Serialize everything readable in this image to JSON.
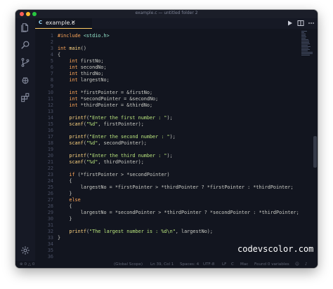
{
  "window": {
    "title": "example.c — untitled folder 2"
  },
  "tab": {
    "lang": "C",
    "filename": "example.c",
    "close": "×"
  },
  "code": [
    {
      "n": "1",
      "segs": [
        {
          "c": "k",
          "t": "#include "
        },
        {
          "c": "g",
          "t": "<stdio.h>"
        }
      ]
    },
    {
      "n": "2",
      "segs": []
    },
    {
      "n": "3",
      "segs": [
        {
          "c": "k",
          "t": "int "
        },
        {
          "c": "f",
          "t": "main"
        },
        {
          "c": "",
          "t": "()"
        }
      ]
    },
    {
      "n": "4",
      "segs": [
        {
          "c": "",
          "t": "{"
        }
      ]
    },
    {
      "n": "5",
      "segs": [
        {
          "c": "",
          "t": "    "
        },
        {
          "c": "k",
          "t": "int "
        },
        {
          "c": "",
          "t": "firstNo;"
        }
      ]
    },
    {
      "n": "6",
      "segs": [
        {
          "c": "",
          "t": "    "
        },
        {
          "c": "k",
          "t": "int "
        },
        {
          "c": "",
          "t": "secondNo;"
        }
      ]
    },
    {
      "n": "7",
      "segs": [
        {
          "c": "",
          "t": "    "
        },
        {
          "c": "k",
          "t": "int "
        },
        {
          "c": "",
          "t": "thirdNo;"
        }
      ]
    },
    {
      "n": "8",
      "segs": [
        {
          "c": "",
          "t": "    "
        },
        {
          "c": "k",
          "t": "int "
        },
        {
          "c": "",
          "t": "largestNo;"
        }
      ]
    },
    {
      "n": "9",
      "segs": []
    },
    {
      "n": "10",
      "segs": [
        {
          "c": "",
          "t": "    "
        },
        {
          "c": "k",
          "t": "int "
        },
        {
          "c": "",
          "t": "*firstPointer = &firstNo;"
        }
      ]
    },
    {
      "n": "11",
      "segs": [
        {
          "c": "",
          "t": "    "
        },
        {
          "c": "k",
          "t": "int "
        },
        {
          "c": "",
          "t": "*secondPointer = &secondNo;"
        }
      ]
    },
    {
      "n": "12",
      "segs": [
        {
          "c": "",
          "t": "    "
        },
        {
          "c": "k",
          "t": "int "
        },
        {
          "c": "",
          "t": "*thirdPointer = &thirdNo;"
        }
      ]
    },
    {
      "n": "13",
      "segs": []
    },
    {
      "n": "14",
      "segs": [
        {
          "c": "",
          "t": "    "
        },
        {
          "c": "f",
          "t": "printf"
        },
        {
          "c": "",
          "t": "("
        },
        {
          "c": "s",
          "t": "\"Enter the first number : \""
        },
        {
          "c": "",
          "t": ");"
        }
      ]
    },
    {
      "n": "15",
      "segs": [
        {
          "c": "",
          "t": "    "
        },
        {
          "c": "f",
          "t": "scanf"
        },
        {
          "c": "",
          "t": "("
        },
        {
          "c": "s",
          "t": "\"%d\""
        },
        {
          "c": "",
          "t": ", firstPointer);"
        }
      ]
    },
    {
      "n": "16",
      "segs": []
    },
    {
      "n": "17",
      "segs": [
        {
          "c": "",
          "t": "    "
        },
        {
          "c": "f",
          "t": "printf"
        },
        {
          "c": "",
          "t": "("
        },
        {
          "c": "s",
          "t": "\"Enter the second number : \""
        },
        {
          "c": "",
          "t": ");"
        }
      ]
    },
    {
      "n": "18",
      "segs": [
        {
          "c": "",
          "t": "    "
        },
        {
          "c": "f",
          "t": "scanf"
        },
        {
          "c": "",
          "t": "("
        },
        {
          "c": "s",
          "t": "\"%d\""
        },
        {
          "c": "",
          "t": ", secondPointer);"
        }
      ]
    },
    {
      "n": "19",
      "segs": []
    },
    {
      "n": "20",
      "segs": [
        {
          "c": "",
          "t": "    "
        },
        {
          "c": "f",
          "t": "printf"
        },
        {
          "c": "",
          "t": "("
        },
        {
          "c": "s",
          "t": "\"Enter the third number : \""
        },
        {
          "c": "",
          "t": ");"
        }
      ]
    },
    {
      "n": "21",
      "segs": [
        {
          "c": "",
          "t": "    "
        },
        {
          "c": "f",
          "t": "scanf"
        },
        {
          "c": "",
          "t": "("
        },
        {
          "c": "s",
          "t": "\"%d\""
        },
        {
          "c": "",
          "t": ", thirdPointer);"
        }
      ]
    },
    {
      "n": "22",
      "segs": []
    },
    {
      "n": "23",
      "segs": [
        {
          "c": "",
          "t": "    "
        },
        {
          "c": "k",
          "t": "if "
        },
        {
          "c": "",
          "t": "(*firstPointer > *secondPointer)"
        }
      ]
    },
    {
      "n": "24",
      "segs": [
        {
          "c": "",
          "t": "    {"
        }
      ]
    },
    {
      "n": "25",
      "segs": [
        {
          "c": "",
          "t": "        largestNo = *firstPointer > *thirdPointer ? *firstPointer : *thirdPointer;"
        }
      ]
    },
    {
      "n": "26",
      "segs": [
        {
          "c": "",
          "t": "    }"
        }
      ]
    },
    {
      "n": "27",
      "segs": [
        {
          "c": "",
          "t": "    "
        },
        {
          "c": "k",
          "t": "else"
        }
      ]
    },
    {
      "n": "28",
      "segs": [
        {
          "c": "",
          "t": "    {"
        }
      ]
    },
    {
      "n": "29",
      "segs": [
        {
          "c": "",
          "t": "        largestNo = *secondPointer > *thirdPointer ? *secondPointer : *thirdPointer;"
        }
      ]
    },
    {
      "n": "30",
      "segs": [
        {
          "c": "",
          "t": "    }"
        }
      ]
    },
    {
      "n": "31",
      "segs": []
    },
    {
      "n": "32",
      "segs": [
        {
          "c": "",
          "t": "    "
        },
        {
          "c": "f",
          "t": "printf"
        },
        {
          "c": "",
          "t": "("
        },
        {
          "c": "s",
          "t": "\"The largest number is : %d\\n\""
        },
        {
          "c": "",
          "t": ", largestNo);"
        }
      ]
    },
    {
      "n": "33",
      "segs": [
        {
          "c": "",
          "t": "}"
        }
      ]
    },
    {
      "n": "34",
      "segs": []
    },
    {
      "n": "35",
      "segs": []
    },
    {
      "n": "36",
      "segs": []
    }
  ],
  "watermark": "codevscolor.com",
  "status": {
    "problems": "⊗ 0 △ 0",
    "scope": "(Global Scope)",
    "position": "Ln 39, Col 1",
    "spaces": "Spaces: 4",
    "encoding": "UTF-8",
    "eol": "LF",
    "language": "C",
    "platform": "Mac",
    "variables": "Found 0 variables"
  },
  "colors": {
    "background": "#12151f",
    "keyword": "#ffa759",
    "string": "#bae67e",
    "function": "#ffd580",
    "tab_accent": "#ffcc66"
  }
}
